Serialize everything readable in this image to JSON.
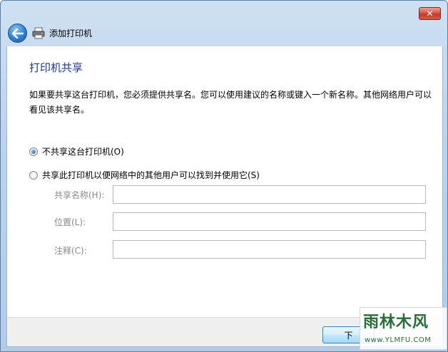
{
  "window": {
    "close_symbol": "✕",
    "title": "添加打印机"
  },
  "page": {
    "heading": "打印机共享",
    "description": "如果要共享这台打印机，您必须提供共享名。您可以使用建议的名称或键入一个新名称。其他网络用户可以看见该共享名。"
  },
  "options": [
    {
      "label": "不共享这台打印机(O)",
      "checked": true
    },
    {
      "label": "共享此打印机以便网络中的其他用户可以找到并使用它(S)",
      "checked": false
    }
  ],
  "fields": [
    {
      "label": "共享名称(H):",
      "value": ""
    },
    {
      "label": "位置(L):",
      "value": ""
    },
    {
      "label": "注释(C):",
      "value": ""
    }
  ],
  "footer": {
    "next_label": "下"
  },
  "watermark": {
    "title": "雨林木风",
    "url": "www.YLMFU.COM"
  }
}
